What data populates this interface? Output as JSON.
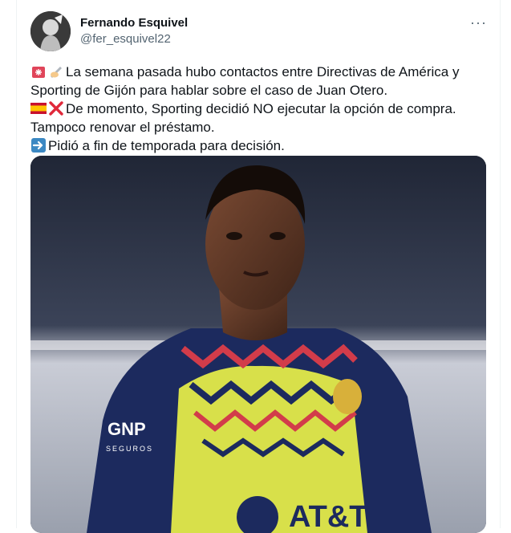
{
  "tweet": {
    "author_name": "Fernando Esquivel",
    "author_handle": "@fer_esquivel22",
    "more_icon": "more-horizontal-icon",
    "lines": [
      "La semana pasada hubo contactos entre Directivas de América y",
      "Sporting de Gijón para hablar sobre el caso de Juan Otero.",
      "De momento, Sporting decidió NO ejecutar la opción de compra.",
      "Tampoco renovar el préstamo.",
      "Pidió a fin de temporada para decisión."
    ],
    "emojis": [
      "siren-icon",
      "writing-hand-icon",
      "spain-flag-icon",
      "cross-mark-icon",
      "right-arrow-icon"
    ]
  },
  "photo": {
    "jersey_sponsor": "AT&T",
    "sleeve_sponsor": "GNP",
    "sleeve_sponsor_sub": "SEGUROS",
    "colors": {
      "jersey_navy": "#1c2a5e",
      "jersey_yellow": "#d8e04a",
      "accent_red": "#d23c4a"
    }
  }
}
